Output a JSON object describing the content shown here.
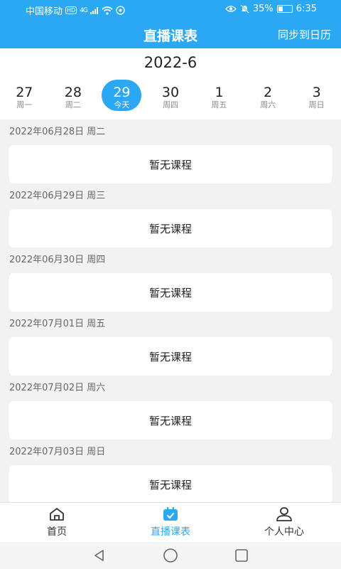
{
  "status_bar": {
    "carrier": "中国移动",
    "hd_badge": "HD",
    "network": "4G",
    "battery_percent": "35%",
    "battery_level": 0.35,
    "time": "6:35"
  },
  "header": {
    "title": "直播课表",
    "sync_label": "同步到日历",
    "accent_color": "#2aa8f2"
  },
  "date_picker": {
    "month_label": "2022-6",
    "days": [
      {
        "num": "27",
        "week": "周一"
      },
      {
        "num": "28",
        "week": "周二"
      },
      {
        "num": "29",
        "week": "今天"
      },
      {
        "num": "30",
        "week": "周四"
      },
      {
        "num": "1",
        "week": "周五"
      },
      {
        "num": "2",
        "week": "周六"
      },
      {
        "num": "3",
        "week": "周日"
      }
    ],
    "selected_index": 2
  },
  "schedule": [
    {
      "date_label": "2022年06月28日 周二",
      "text": "暂无课程"
    },
    {
      "date_label": "2022年06月29日 周三",
      "text": "暂无课程"
    },
    {
      "date_label": "2022年06月30日 周四",
      "text": "暂无课程"
    },
    {
      "date_label": "2022年07月01日 周五",
      "text": "暂无课程"
    },
    {
      "date_label": "2022年07月02日 周六",
      "text": "暂无课程"
    },
    {
      "date_label": "2022年07月03日 周日",
      "text": "暂无课程"
    }
  ],
  "bottom_nav": {
    "items": [
      {
        "label": "首页",
        "icon": "home-icon"
      },
      {
        "label": "直播课表",
        "icon": "calendar-icon"
      },
      {
        "label": "个人中心",
        "icon": "user-icon"
      }
    ],
    "active_index": 1
  },
  "system_nav": [
    "back-icon",
    "home-circle-icon",
    "recents-icon"
  ]
}
